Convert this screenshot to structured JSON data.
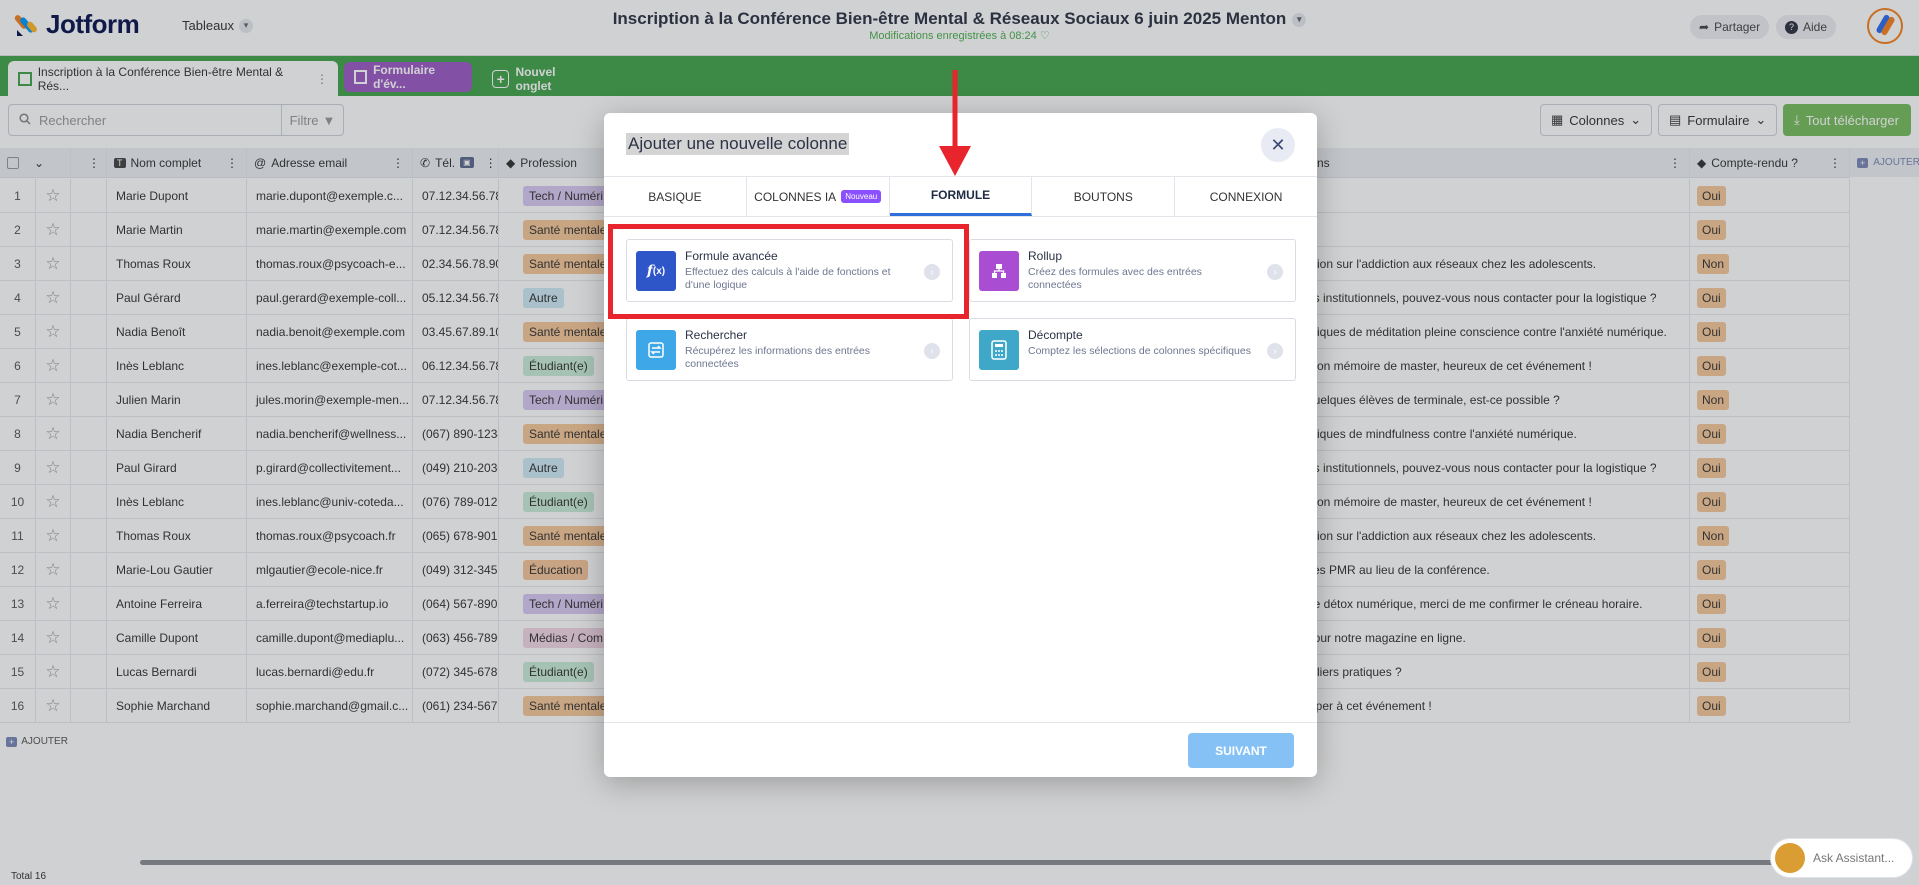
{
  "app": {
    "brand": "Jotform",
    "workspace_label": "Tableaux",
    "title": "Inscription à la Conférence Bien-être Mental & Réseaux Sociaux 6 juin 2025 Menton",
    "saved_status": "Modifications enregistrées à 08:24",
    "share_label": "Partager",
    "help_label": "Aide"
  },
  "tabs": {
    "active_label": "Inscription à la Conférence Bien-être Mental & Rés...",
    "form_label": "Formulaire d'év...",
    "new_tab_label": "Nouvel onglet"
  },
  "toolbar": {
    "search_placeholder": "Rechercher",
    "filter_label": "Filtre",
    "columns_label": "Colonnes",
    "form_label": "Formulaire",
    "download_label": "Tout télécharger"
  },
  "grid": {
    "headers": {
      "name": "Nom complet",
      "email": "Adresse email",
      "tel": "Tél.",
      "profession": "Profession",
      "questions": "ns",
      "report": "Compte-rendu ?",
      "add": "AJOUTER"
    },
    "rows": [
      {
        "n": "1",
        "name": "Marie Dupont",
        "email": "marie.dupont@exemple.c...",
        "tel": "07.12.34.56.78",
        "prof": "Tech / Numéri",
        "prof_color": "#d9c9f2",
        "q": "",
        "report": "Oui"
      },
      {
        "n": "2",
        "name": "Marie Martin",
        "email": "marie.martin@exemple.com",
        "tel": "07.12.34.56.78",
        "prof": "Santé mentale",
        "prof_color": "#f7c89a",
        "q": "",
        "report": "Oui"
      },
      {
        "n": "3",
        "name": "Thomas Roux",
        "email": "thomas.roux@psycoach-e...",
        "tel": "02.34.56.78.90",
        "prof": "Santé mentale",
        "prof_color": "#f7c89a",
        "q": "ation sur l'addiction aux réseaux chez les adolescents.",
        "report": "Non"
      },
      {
        "n": "4",
        "name": "Paul Gérard",
        "email": "paul.gerard@exemple-coll...",
        "tel": "05.12.34.56.78",
        "prof": "Autre",
        "prof_color": "#cfe9f5",
        "q": "es institutionnels, pouvez-vous nous contacter pour la logistique ?",
        "report": "Oui"
      },
      {
        "n": "5",
        "name": "Nadia Benoît",
        "email": "nadia.benoit@exemple.com",
        "tel": "03.45.67.89.10",
        "prof": "Santé mentale",
        "prof_color": "#f7c89a",
        "q": "atiques de méditation pleine conscience contre l'anxiété numérique.",
        "report": "Oui"
      },
      {
        "n": "6",
        "name": "Inès Leblanc",
        "email": "ines.leblanc@exemple-cot...",
        "tel": "06.12.34.56.78",
        "prof": "Étudiant(e)",
        "prof_color": "#c8ecd9",
        "q": "mon mémoire de master, heureux de cet événement !",
        "report": "Oui"
      },
      {
        "n": "7",
        "name": "Julien Marin",
        "email": "jules.morin@exemple-men...",
        "tel": "07.12.34.56.78",
        "prof": "Tech / Numéri",
        "prof_color": "#d9c9f2",
        "q": "quelques élèves de terminale, est-ce possible ?",
        "report": "Non"
      },
      {
        "n": "8",
        "name": "Nadia Bencherif",
        "email": "nadia.bencherif@wellness...",
        "tel": "(067) 890-1234",
        "prof": "Santé mentale",
        "prof_color": "#f7c89a",
        "q": "atiques de mindfulness contre l'anxiété numérique.",
        "report": "Oui"
      },
      {
        "n": "9",
        "name": "Paul Girard",
        "email": "p.girard@collectivitement...",
        "tel": "(049) 210-2030",
        "prof": "Autre",
        "prof_color": "#cfe9f5",
        "q": "es institutionnels, pouvez-vous nous contacter pour la logistique ?",
        "report": "Oui"
      },
      {
        "n": "10",
        "name": "Inès Leblanc",
        "email": "ines.leblanc@univ-coteda...",
        "tel": "(076) 789-0123",
        "prof": "Étudiant(e)",
        "prof_color": "#c8ecd9",
        "q": "mon mémoire de master, heureux de cet événement !",
        "report": "Oui"
      },
      {
        "n": "11",
        "name": "Thomas Roux",
        "email": "thomas.roux@psycoach.fr",
        "tel": "(065) 678-9012",
        "prof": "Santé mentale",
        "prof_color": "#f7c89a",
        "q": "ation sur l'addiction aux réseaux chez les adolescents.",
        "report": "Non"
      },
      {
        "n": "12",
        "name": "Marie-Lou Gautier",
        "email": "mlgautier@ecole-nice.fr",
        "tel": "(049) 312-3456",
        "prof": "Éducation",
        "prof_color": "#f5c49b",
        "q": "cès PMR au lieu de la conférence.",
        "report": "Oui"
      },
      {
        "n": "13",
        "name": "Antoine Ferreira",
        "email": "a.ferreira@techstartup.io",
        "tel": "(064) 567-8901",
        "prof": "Tech / Numéri",
        "prof_color": "#d9c9f2",
        "q": "de détox numérique, merci de me confirmer le créneau horaire.",
        "report": "Oui"
      },
      {
        "n": "14",
        "name": "Camille Dupont",
        "email": "camille.dupont@mediaplu...",
        "tel": "(063) 456-7890",
        "prof": "Médias / Com",
        "prof_color": "#f3d6e6",
        "q": "pour notre magazine en ligne.",
        "report": "Oui"
      },
      {
        "n": "15",
        "name": "Lucas Bernardi",
        "email": "lucas.bernardi@edu.fr",
        "tel": "(072) 345-6789",
        "prof": "Étudiant(e)",
        "prof_color": "#c8ecd9",
        "q": "teliers pratiques ?",
        "report": "Oui"
      },
      {
        "n": "16",
        "name": "Sophie Marchand",
        "email": "sophie.marchand@gmail.c...",
        "tel": "(061) 234-5678",
        "prof": "Santé mentale",
        "prof_color": "#f7c89a",
        "q": "ciper à cet événement !",
        "report": "Oui"
      }
    ],
    "add_row_label": "AJOUTER",
    "total_label": "Total 16"
  },
  "modal": {
    "title": "Ajouter une nouvelle colonne",
    "tabs": [
      "BASIQUE",
      "COLONNES IA",
      "FORMULE",
      "BOUTONS",
      "CONNEXION"
    ],
    "new_badge": "Nouveau",
    "cards": [
      {
        "title": "Formule avancée",
        "desc": "Effectuez des calculs à l'aide de fonctions et d'une logique",
        "icon": "formula-icon",
        "color": "#2e56c9"
      },
      {
        "title": "Rollup",
        "desc": "Créez des formules avec des entrées connectées",
        "icon": "rollup-icon",
        "color": "#a94ed3"
      },
      {
        "title": "Rechercher",
        "desc": "Récupérez les informations des entrées connectées",
        "icon": "lookup-icon",
        "color": "#3ea7e8"
      },
      {
        "title": "Décompte",
        "desc": "Comptez les sélections de colonnes spécifiques",
        "icon": "calculator-icon",
        "color": "#3fa8c9"
      }
    ],
    "next_label": "SUIVANT"
  },
  "assistant_label": "Ask Assistant..."
}
